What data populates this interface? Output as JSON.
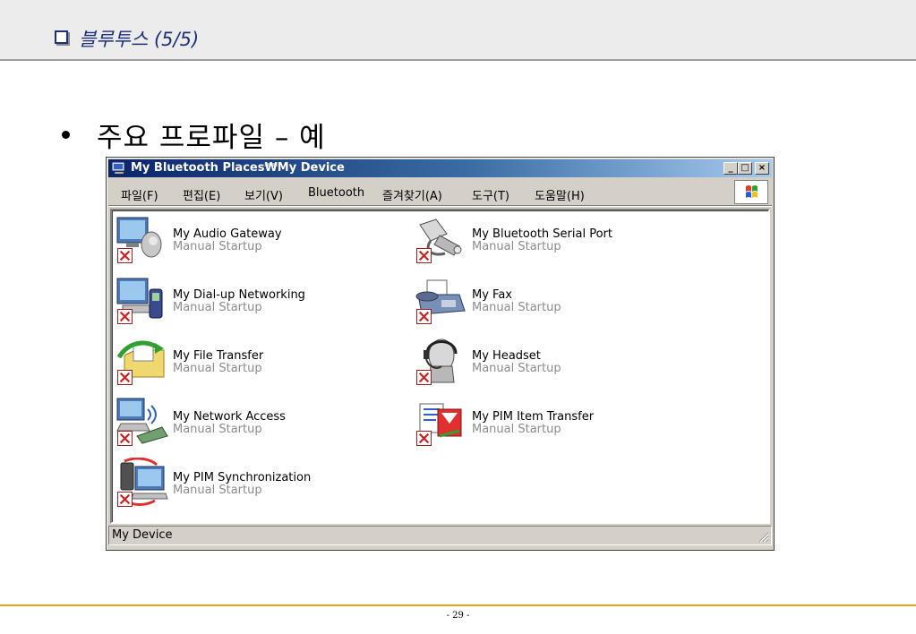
{
  "slide": {
    "title": "블루투스 (5/5)",
    "bullet": "주요 프로파일 – 예",
    "page_number": "- 29 -"
  },
  "window": {
    "title": "My Bluetooth Places₩My Device",
    "menu": [
      "파일(F)",
      "편집(E)",
      "보기(V)",
      "Bluetooth",
      "즐겨찾기(A)",
      "도구(T)",
      "도움말(H)"
    ],
    "controls": {
      "minimize": "_",
      "maximize": "□",
      "close": "×"
    },
    "devices": [
      {
        "name": "My Audio Gateway",
        "status": "Manual Startup",
        "icon": "audio-gateway-icon"
      },
      {
        "name": "My Bluetooth Serial Port",
        "status": "Manual Startup",
        "icon": "serial-port-icon"
      },
      {
        "name": "My Dial-up Networking",
        "status": "Manual Startup",
        "icon": "dialup-networking-icon"
      },
      {
        "name": "My Fax",
        "status": "Manual Startup",
        "icon": "fax-icon"
      },
      {
        "name": "My File Transfer",
        "status": "Manual Startup",
        "icon": "file-transfer-icon"
      },
      {
        "name": "My Headset",
        "status": "Manual Startup",
        "icon": "headset-icon"
      },
      {
        "name": "My Network Access",
        "status": "Manual Startup",
        "icon": "network-access-icon"
      },
      {
        "name": "My PIM Item Transfer",
        "status": "Manual Startup",
        "icon": "pim-item-transfer-icon"
      },
      {
        "name": "My PIM Synchronization",
        "status": "Manual Startup",
        "icon": "pim-sync-icon"
      }
    ],
    "status_bar": "My Device"
  },
  "colors": {
    "title_blue": "#1f2f7a",
    "titlebar_start": "#0a246a",
    "titlebar_end": "#a6caf0",
    "footer_orange": "#f0a020",
    "status_gray": "#8c8c8c"
  }
}
